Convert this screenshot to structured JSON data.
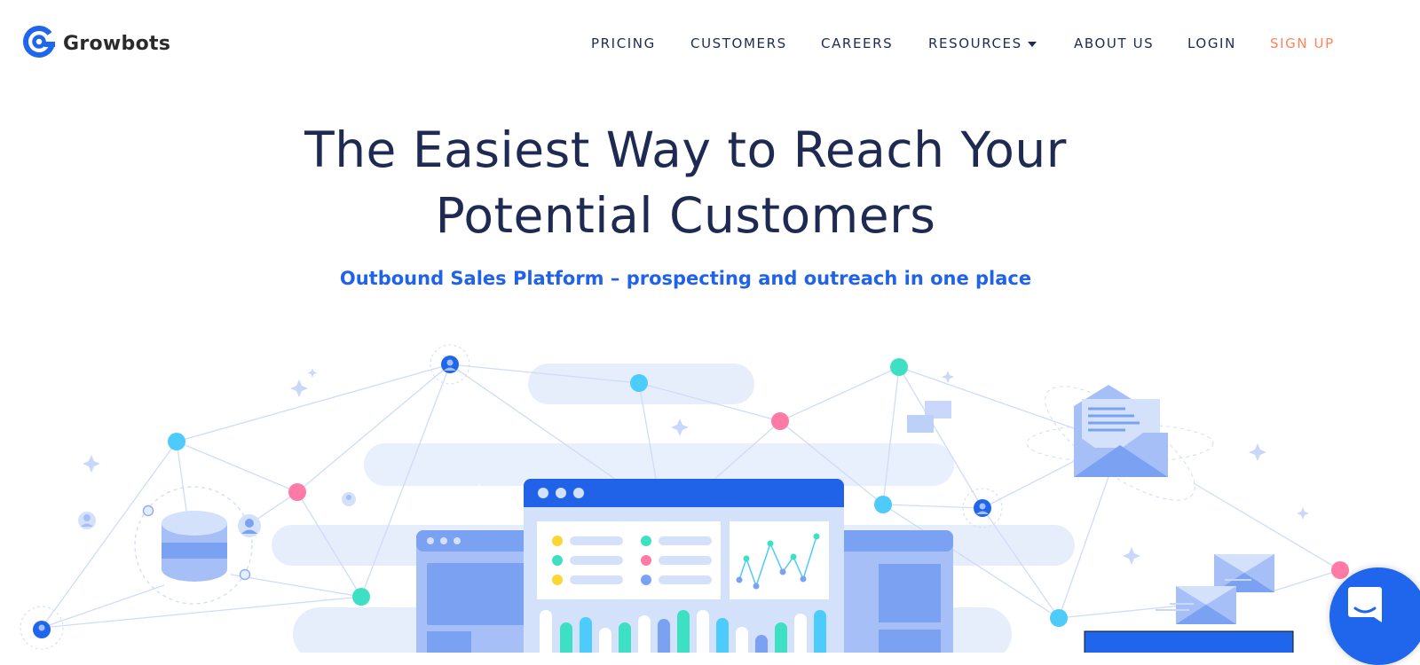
{
  "brand": {
    "name": "Growbots",
    "logo_icon": "growbots-g-logo-icon",
    "accent_color": "#2063e9",
    "signup_color": "#ff8259",
    "text_color": "#1e2a52"
  },
  "nav": {
    "items": [
      {
        "label": "PRICING"
      },
      {
        "label": "CUSTOMERS"
      },
      {
        "label": "CAREERS"
      },
      {
        "label": "RESOURCES",
        "has_dropdown": true
      },
      {
        "label": "ABOUT US"
      },
      {
        "label": "LOGIN"
      },
      {
        "label": "SIGN UP"
      }
    ]
  },
  "hero": {
    "title_line1": "The Easiest Way to Reach Your",
    "title_line2": "Potential Customers",
    "subtitle": "Outbound Sales Platform – prospecting and outreach in one place"
  },
  "illustration": {
    "description": "network-of-contacts-dashboard-illustration",
    "icons": [
      "database-icon",
      "person-icon",
      "envelope-icon",
      "dashboard-window-icon",
      "line-chart-icon",
      "bar-chart-icon",
      "sparkle-icon"
    ]
  },
  "chat_widget": {
    "icon": "chat-bubble-icon"
  }
}
